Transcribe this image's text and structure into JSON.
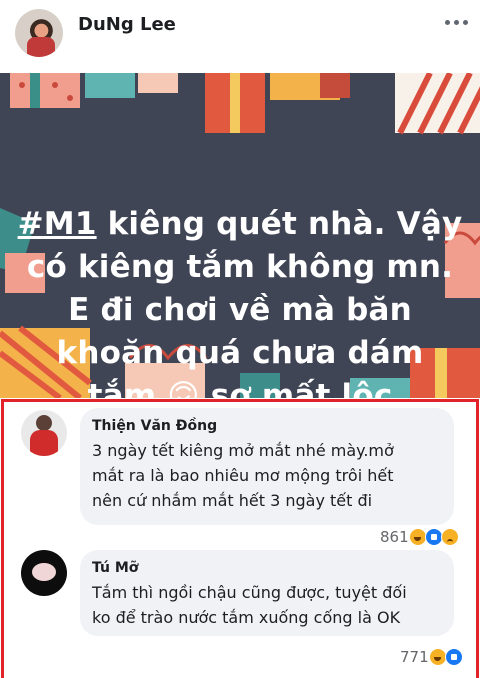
{
  "post": {
    "author": "DuNg Lee",
    "text_lines": [
      "kiêng quét nhà. Vậy",
      "có kiêng tắm không mn.",
      "E đi chơi về mà băn",
      "khoăn quá chưa dám",
      "tắm",
      "sợ  mất lộc"
    ],
    "hashtag": "#M1",
    "emoji": "🙃"
  },
  "comments": [
    {
      "name": "Thiện Văn Đồng",
      "text_lines": [
        "3 ngày tết kiêng mở mắt nhé mày.mở",
        "mắt ra là bao nhiêu mơ mộng trôi hết",
        "nên cứ nhắm mắt hết 3 ngày tết đi"
      ],
      "reaction_count": "861",
      "reactions": [
        "haha-icon",
        "like-icon",
        "sad-icon"
      ]
    },
    {
      "name": "Tú Mỡ",
      "text_lines": [
        "Tắm thì ngồi chậu cũng được, tuyệt đối",
        "ko để trào nước tắm xuống cống là OK"
      ],
      "reaction_count": "771",
      "reactions": [
        "haha-icon",
        "like-icon"
      ]
    }
  ],
  "colors": {
    "highlight_border": "#e0242a",
    "post_background": "#404556",
    "bubble": "#f0f2f5"
  }
}
